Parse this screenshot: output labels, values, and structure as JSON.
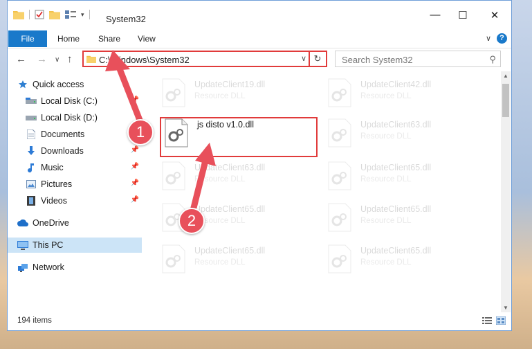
{
  "window": {
    "title": "System32",
    "controls": {
      "minimize": "—",
      "maximize": "☐",
      "close": "✕"
    }
  },
  "ribbon": {
    "tabs": [
      "File",
      "Home",
      "Share",
      "View"
    ],
    "expand_icon": "∨",
    "help_icon": "?"
  },
  "address": {
    "path": "C:\\Windows\\System32",
    "dropdown_icon": "∨",
    "refresh_icon": "↻"
  },
  "search": {
    "placeholder": "Search System32",
    "icon": "⚲"
  },
  "nav_buttons": {
    "back": "←",
    "forward": "→",
    "history": "∨",
    "up": "↑"
  },
  "nav_pane": {
    "quick_access": "Quick access",
    "items": [
      {
        "label": "Local Disk (C:)",
        "pinned": true
      },
      {
        "label": "Local Disk (D:)",
        "pinned": false
      },
      {
        "label": "Documents",
        "pinned": true
      },
      {
        "label": "Downloads",
        "pinned": true
      },
      {
        "label": "Music",
        "pinned": true
      },
      {
        "label": "Pictures",
        "pinned": true
      },
      {
        "label": "Videos",
        "pinned": true
      }
    ],
    "onedrive": "OneDrive",
    "this_pc": "This PC",
    "network": "Network"
  },
  "files": [
    {
      "name": "UpdateClient19.dll",
      "type": "Resource DLL"
    },
    {
      "name": "UpdateClient42.dll",
      "type": "Resource DLL"
    },
    {
      "name": "js disto v1.0.dll",
      "type": ""
    },
    {
      "name": "UpdateClient63.dll",
      "type": "Resource DLL"
    },
    {
      "name": "UpdateClient63.dll",
      "type": "Resource DLL"
    },
    {
      "name": "UpdateClient65.dll",
      "type": "Resource DLL"
    },
    {
      "name": "UpdateClient65.dll",
      "type": "Resource DLL"
    },
    {
      "name": "UpdateClient65.dll",
      "type": "Resource DLL"
    },
    {
      "name": "UpdateClient65.dll",
      "type": "Resource DLL"
    },
    {
      "name": "UpdateClient65.dll",
      "type": "Resource DLL"
    }
  ],
  "status": {
    "item_count": "194 items"
  },
  "annotations": {
    "step1": "1",
    "step2": "2"
  },
  "colors": {
    "accent": "#1979ca",
    "highlight": "#e13b3b",
    "arrow": "#e8505b",
    "selection": "#cce4f7"
  }
}
